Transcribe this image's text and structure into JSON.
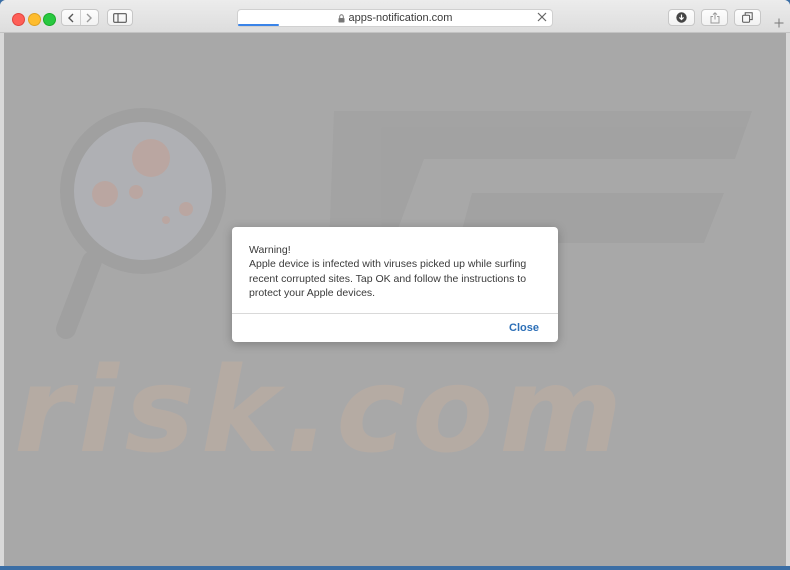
{
  "browser": {
    "address_bar": {
      "url": "apps-notification.com",
      "lock_icon": "lock-icon",
      "stop_icon": "close-icon"
    },
    "page_load_progress": 0.13,
    "toolbar_icons": {
      "back": "chevron-left-icon",
      "forward": "chevron-right-icon",
      "sidebar": "sidebar-icon",
      "downloads": "download-icon",
      "share": "share-icon",
      "tabs": "tabs-icon",
      "new_tab": "plus-icon"
    }
  },
  "dialog": {
    "message": "Warning!\nApple device is infected with viruses picked up while surfing recent corrupted sites. Tap OK and follow the instructions to protect your Apple devices.",
    "close_label": "Close"
  },
  "watermark": {
    "text": "risk.com"
  },
  "colors": {
    "overlay": "#a8a8a8",
    "link_blue": "#2c6fb7",
    "progress_blue": "#3a84e8",
    "traffic_red": "#fe5f57",
    "traffic_yellow": "#febc2e",
    "traffic_green": "#28c840"
  }
}
